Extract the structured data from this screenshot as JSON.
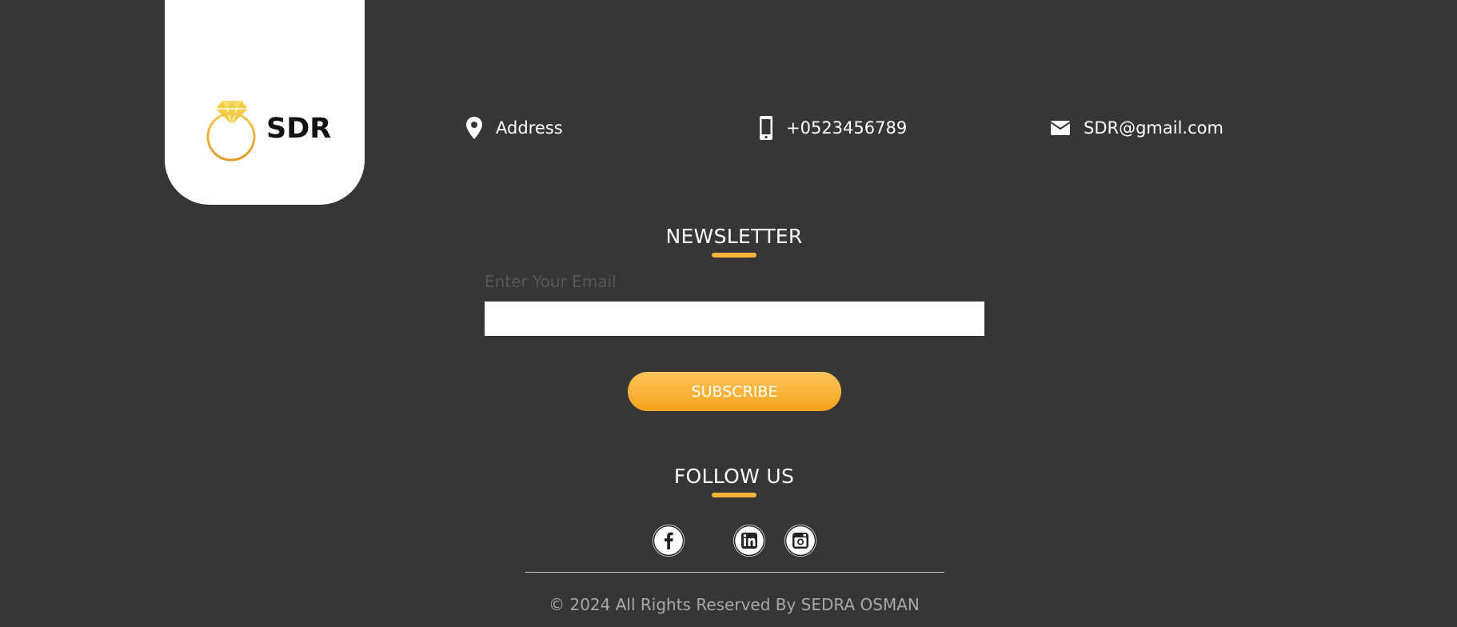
{
  "brand": {
    "name": "SDR",
    "logo_icon": "diamond-ring-icon",
    "accent_color": "#f6b337"
  },
  "contact": {
    "address": {
      "icon": "location-pin-icon",
      "text": "Address"
    },
    "phone": {
      "icon": "mobile-phone-icon",
      "text": "+0523456789"
    },
    "email": {
      "icon": "envelope-icon",
      "text": "SDR@gmail.com"
    }
  },
  "newsletter": {
    "title": "NEWSLETTER",
    "email_label": "Enter Your Email",
    "email_value": "",
    "subscribe_label": "SUBSCRIBE"
  },
  "follow": {
    "title": "FOLLOW US",
    "icons": [
      "facebook-icon",
      "linkedin-icon",
      "instagram-icon"
    ]
  },
  "footer": {
    "copyright": "© 2024 All Rights Reserved By SEDRA OSMAN"
  }
}
